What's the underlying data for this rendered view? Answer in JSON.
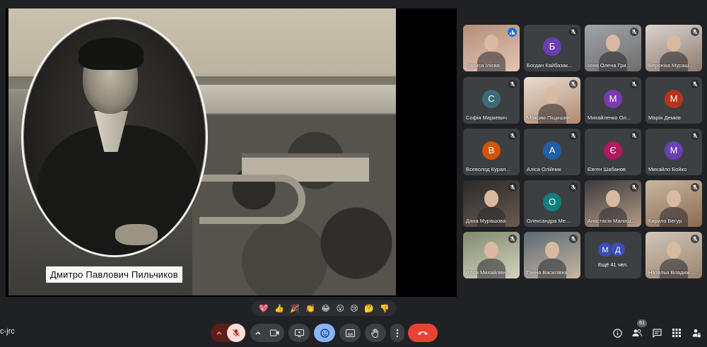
{
  "slide": {
    "caption": "Дмитро Павлович Пильчиков"
  },
  "participants": [
    {
      "name": "Лариса Ілієва",
      "kind": "video",
      "speaking": true
    },
    {
      "name": "Богдан Кайбазак...",
      "kind": "avatar",
      "initial": "Б",
      "color": "#6a3fb5",
      "muted": true
    },
    {
      "name": "Іхіна Олена Гри...",
      "kind": "video",
      "muted": true
    },
    {
      "name": "Вероніка Мураш...",
      "kind": "video",
      "muted": true
    },
    {
      "name": "Софія Маркевич",
      "kind": "avatar",
      "initial": "С",
      "color": "#3b6b78",
      "muted": true
    },
    {
      "name": "Максим Піщишин",
      "kind": "video",
      "muted": true
    },
    {
      "name": "Михайленко Ол...",
      "kind": "avatar",
      "initial": "М",
      "color": "#7b3ab0",
      "muted": true
    },
    {
      "name": "Марія Демків",
      "kind": "avatar",
      "initial": "М",
      "color": "#b5341b",
      "muted": true
    },
    {
      "name": "Всеволод Курал...",
      "kind": "avatar",
      "initial": "В",
      "color": "#d35400",
      "muted": true
    },
    {
      "name": "Аліса Олійник",
      "kind": "avatar",
      "initial": "А",
      "color": "#1f5fa8",
      "muted": true
    },
    {
      "name": "Євген Шабанов",
      "kind": "avatar",
      "initial": "Є",
      "color": "#b0185f",
      "muted": true
    },
    {
      "name": "Михайло Бойко",
      "kind": "avatar",
      "initial": "М",
      "color": "#6a3fb5",
      "muted": true
    },
    {
      "name": "Дана Мурашова",
      "kind": "video",
      "muted": true
    },
    {
      "name": "Олександра Ме...",
      "kind": "avatar",
      "initial": "О",
      "color": "#117f7f",
      "muted": true
    },
    {
      "name": "Анастасія Малиш...",
      "kind": "video",
      "muted": true
    },
    {
      "name": "Кирило Бегур",
      "kind": "video",
      "muted": true
    },
    {
      "name": "Алла Михайлівн...",
      "kind": "video",
      "muted": true
    },
    {
      "name": "Ганна Василівна ...",
      "kind": "video",
      "muted": true
    },
    {
      "name": "Ещё 41 чел.",
      "kind": "more",
      "initials": [
        "М",
        "Д"
      ],
      "colors": [
        "#3b4db8",
        "#3b4db8"
      ]
    },
    {
      "name": "Наталья Владим...",
      "kind": "video",
      "muted": true
    }
  ],
  "reactions": [
    "💖",
    "👍",
    "🎉",
    "👏",
    "😂",
    "😮",
    "😢",
    "🤔",
    "👎"
  ],
  "footer": {
    "meeting_code": "c-jrc",
    "participant_count": "61"
  },
  "colors": {
    "background": "#202124",
    "control": "#3c4043",
    "muted_red": "#ea4335",
    "end_call": "#ea4335",
    "active_blue": "#8ab4f8"
  }
}
